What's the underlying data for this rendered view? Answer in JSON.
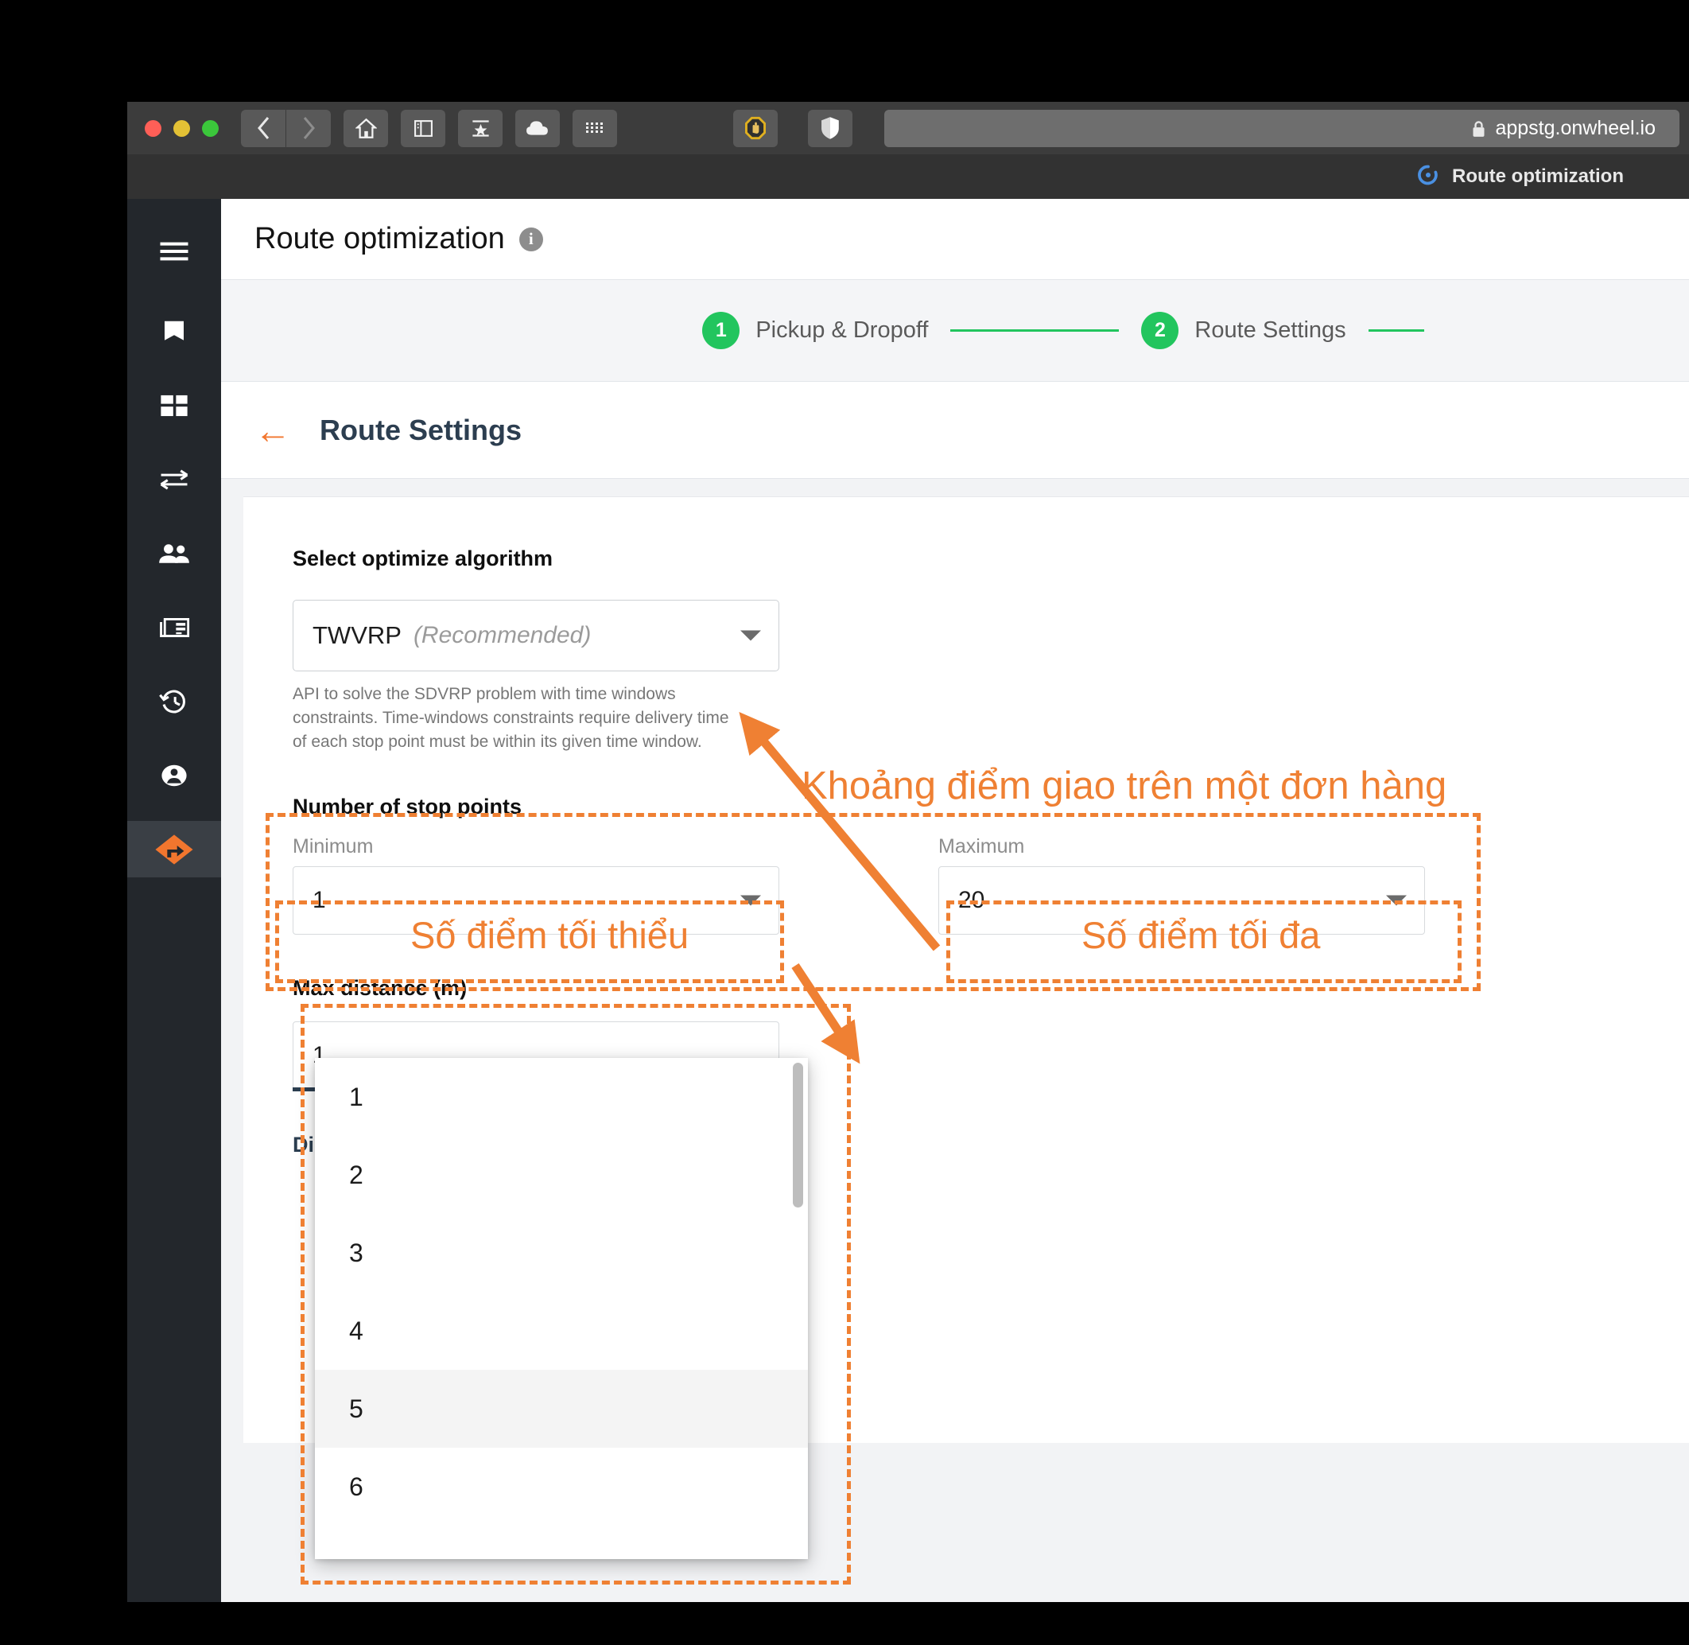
{
  "browser": {
    "url": "appstg.onwheel.io",
    "tab_title": "Route optimization",
    "toolbar_icons": [
      "back-icon",
      "forward-icon",
      "home-icon",
      "sidebar-icon",
      "reading-list-icon",
      "cloud-icon",
      "apps-grid-icon",
      "adblock-icon",
      "shield-icon"
    ]
  },
  "sidebar": {
    "items": [
      {
        "name": "menu-icon",
        "label": "Menu"
      },
      {
        "name": "bookmark-icon",
        "label": "Bookmarks"
      },
      {
        "name": "dashboard-icon",
        "label": "Dashboard"
      },
      {
        "name": "transfer-icon",
        "label": "Transfers"
      },
      {
        "name": "people-icon",
        "label": "Customers"
      },
      {
        "name": "articles-icon",
        "label": "Orders"
      },
      {
        "name": "history-icon",
        "label": "History"
      },
      {
        "name": "account-icon",
        "label": "Account"
      },
      {
        "name": "route-sign-icon",
        "label": "Route optimization"
      }
    ]
  },
  "header": {
    "title": "Route optimization",
    "info_badge": "i"
  },
  "stepper": {
    "steps": [
      {
        "number": "1",
        "label": "Pickup & Dropoff"
      },
      {
        "number": "2",
        "label": "Route Settings"
      }
    ],
    "active_color": "#22c55e"
  },
  "subheader": {
    "back_icon": "←",
    "title": "Route Settings"
  },
  "form": {
    "algorithm": {
      "label": "Select optimize algorithm",
      "value": "TWVRP",
      "value_suffix": "(Recommended)",
      "description": "API to solve the SDVRP problem with time windows constraints. Time-windows constraints require delivery time of each stop point must be within its given time window."
    },
    "stop_points": {
      "label": "Number of stop points",
      "minimum": {
        "float_label": "Minimum",
        "value": "1"
      },
      "maximum": {
        "float_label": "Maximum",
        "value": "20"
      }
    },
    "max_distance": {
      "label": "Max distance (m)",
      "value": "1"
    },
    "next_section": {
      "label": "Di"
    }
  },
  "dropdown": {
    "options": [
      "1",
      "2",
      "3",
      "4",
      "5",
      "6"
    ],
    "highlighted": "5"
  },
  "annotations": {
    "accent_color": "#ef8033",
    "title": "Khoảng điểm giao trên một đơn hàng",
    "minimum_note": "Số điểm tối thiểu",
    "maximum_note": "Số điểm tối đa"
  }
}
